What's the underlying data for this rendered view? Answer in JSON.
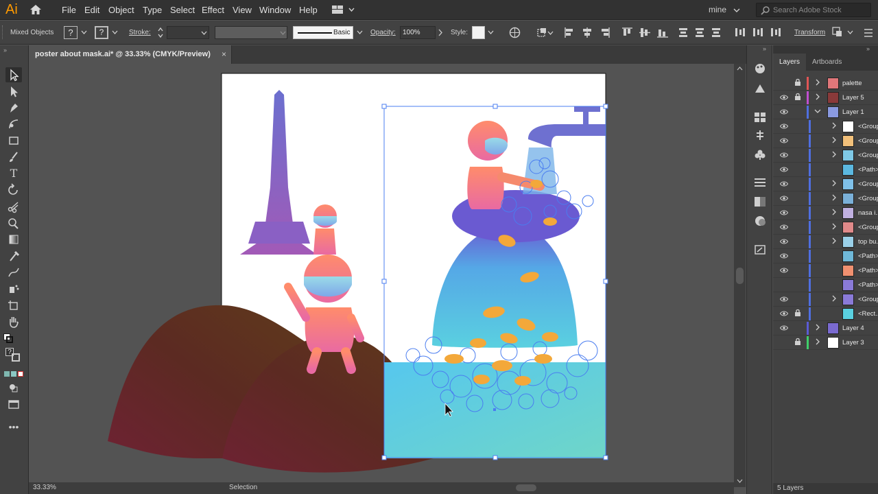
{
  "app": {
    "logo": "Ai"
  },
  "menu": [
    "File",
    "Edit",
    "Object",
    "Type",
    "Select",
    "Effect",
    "View",
    "Window",
    "Help"
  ],
  "workspace": "mine",
  "search": {
    "placeholder": "Search Adobe Stock"
  },
  "control_bar": {
    "selection_label": "Mixed Objects",
    "stroke_label": "Stroke:",
    "brush_label": "Basic",
    "opacity_label": "Opacity:",
    "opacity_value": "100%",
    "style_label": "Style:",
    "transform_label": "Transform",
    "mixed_marker": "?"
  },
  "document_tab": {
    "title": "poster about mask.ai* @ 33.33% (CMYK/Preview)",
    "close": "×"
  },
  "status": {
    "zoom": "33.33%",
    "tool": "Selection",
    "layers_count": "5 Layers"
  },
  "panel": {
    "tabs": [
      "Layers",
      "Artboards"
    ],
    "active_tab": "Layers"
  },
  "layers": [
    {
      "name": "palette",
      "color": "#e05555",
      "locked": true,
      "visible": false,
      "expandable": true,
      "level": 0
    },
    {
      "name": "Layer 5",
      "color": "#c04fd0",
      "locked": true,
      "visible": true,
      "expandable": true,
      "level": 0
    },
    {
      "name": "Layer 1",
      "color": "#4f6fe0",
      "locked": false,
      "visible": true,
      "expandable": true,
      "expanded": true,
      "level": 0
    },
    {
      "name": "<Group>",
      "color": "#4f6fe0",
      "locked": false,
      "visible": true,
      "expandable": true,
      "level": 1
    },
    {
      "name": "<Group>",
      "color": "#4f6fe0",
      "locked": false,
      "visible": true,
      "expandable": true,
      "level": 1
    },
    {
      "name": "<Group>",
      "color": "#4f6fe0",
      "locked": false,
      "visible": true,
      "expandable": true,
      "level": 1
    },
    {
      "name": "<Path>",
      "color": "#4f6fe0",
      "locked": false,
      "visible": true,
      "expandable": false,
      "level": 1
    },
    {
      "name": "<Group>",
      "color": "#4f6fe0",
      "locked": false,
      "visible": true,
      "expandable": true,
      "level": 1
    },
    {
      "name": "<Group>",
      "color": "#4f6fe0",
      "locked": false,
      "visible": true,
      "expandable": true,
      "level": 1
    },
    {
      "name": "nasa i...",
      "color": "#4f6fe0",
      "locked": false,
      "visible": true,
      "expandable": true,
      "level": 1
    },
    {
      "name": "<Group>",
      "color": "#4f6fe0",
      "locked": false,
      "visible": true,
      "expandable": true,
      "level": 1
    },
    {
      "name": "top bu...",
      "color": "#4f6fe0",
      "locked": false,
      "visible": true,
      "expandable": true,
      "level": 1
    },
    {
      "name": "<Path>",
      "color": "#4f6fe0",
      "locked": false,
      "visible": true,
      "expandable": false,
      "level": 1
    },
    {
      "name": "<Path>",
      "color": "#4f6fe0",
      "locked": false,
      "visible": true,
      "expandable": false,
      "level": 1
    },
    {
      "name": "<Path>",
      "color": "#4f6fe0",
      "locked": false,
      "visible": false,
      "expandable": false,
      "level": 1
    },
    {
      "name": "<Group>",
      "color": "#4f6fe0",
      "locked": false,
      "visible": true,
      "expandable": true,
      "level": 1
    },
    {
      "name": "<Rect...",
      "color": "#4f6fe0",
      "locked": true,
      "visible": true,
      "expandable": false,
      "level": 1
    },
    {
      "name": "Layer 4",
      "color": "#5b5bd6",
      "locked": false,
      "visible": true,
      "expandable": true,
      "level": 0
    },
    {
      "name": "Layer 3",
      "color": "#3fcf6a",
      "locked": true,
      "visible": false,
      "expandable": true,
      "level": 0
    }
  ],
  "colors": {
    "accent": "#ff9a00",
    "selection": "#4a7df0"
  }
}
